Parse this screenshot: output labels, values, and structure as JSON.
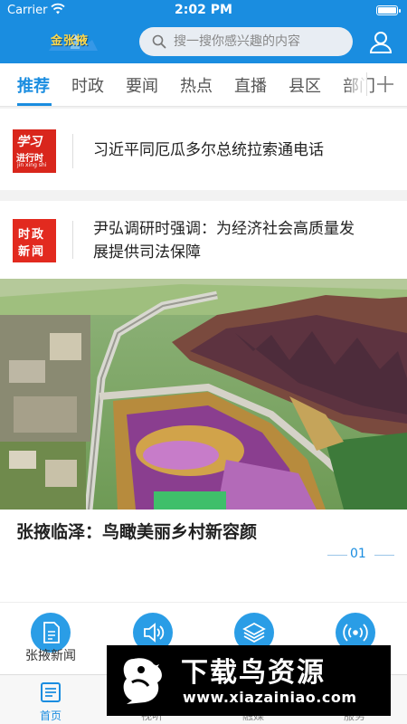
{
  "status_bar": {
    "carrier": "Carrier",
    "time": "2:02 PM"
  },
  "header": {
    "logo_text": "金张掖",
    "search": {
      "placeholder": "搜一搜你感兴趣的内容"
    }
  },
  "tabs": [
    {
      "label": "推荐",
      "active": true
    },
    {
      "label": "时政"
    },
    {
      "label": "要闻"
    },
    {
      "label": "热点"
    },
    {
      "label": "直播"
    },
    {
      "label": "县区"
    },
    {
      "label": "部门"
    }
  ],
  "news": [
    {
      "badge": {
        "line1": "学习",
        "line2": "进行时",
        "line3": "jin xing shi"
      },
      "title": "习近平同厄瓜多尔总统拉索通电话"
    },
    {
      "badge": {
        "line1": "时政",
        "line2": "新闻"
      },
      "title_line1": "尹弘调研时强调：为经济社会高质量发",
      "title_line2": "展提供司法保障"
    }
  ],
  "hero": {
    "caption": "张掖临泽：鸟瞰美丽乡村新容颜",
    "page_number": "01"
  },
  "services": [
    {
      "label": "张掖新闻",
      "icon": "document-icon"
    },
    {
      "label": "",
      "icon": "speaker-icon"
    },
    {
      "label": "",
      "icon": "layers-icon"
    },
    {
      "label": "",
      "icon": "broadcast-icon"
    }
  ],
  "bottom_nav": [
    {
      "label": "首页",
      "active": true,
      "icon": "newspaper-icon"
    },
    {
      "label": "视听"
    },
    {
      "label": "融媒"
    },
    {
      "label": "服务"
    }
  ],
  "watermark": {
    "title": "下载鸟资源",
    "url": "www.xiazainiao.com"
  },
  "colors": {
    "primary": "#1a8de0",
    "badge_red": "#d9261c"
  }
}
